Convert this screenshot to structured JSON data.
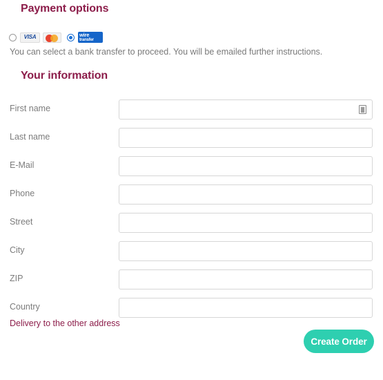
{
  "payment": {
    "heading": "Payment options",
    "note": "You can select a bank transfer to proceed. You will be emailed further instructions.",
    "options": [
      {
        "id": "card",
        "selected": false,
        "radio_name": "payment-radio-card",
        "logos": [
          {
            "name": "visa-logo",
            "text": "VISA"
          },
          {
            "name": "mastercard-logo",
            "text": ""
          }
        ]
      },
      {
        "id": "wire",
        "selected": true,
        "radio_name": "payment-radio-wire",
        "logos": [
          {
            "name": "wire-transfer-logo",
            "line1": "wire",
            "line2": "transfer"
          }
        ]
      }
    ],
    "wire_logo_line1": "wire",
    "wire_logo_line2": "transfer",
    "visa_logo_text": "VISA"
  },
  "information": {
    "heading": "Your information",
    "fields": [
      {
        "label": "First name",
        "value": "",
        "placeholder": "",
        "name": "first-name-input",
        "has_autofill_icon": true
      },
      {
        "label": "Last name",
        "value": "",
        "placeholder": "",
        "name": "last-name-input",
        "has_autofill_icon": false
      },
      {
        "label": "E-Mail",
        "value": "",
        "placeholder": "",
        "name": "email-input",
        "has_autofill_icon": false
      },
      {
        "label": "Phone",
        "value": "",
        "placeholder": "",
        "name": "phone-input",
        "has_autofill_icon": false
      },
      {
        "label": "Street",
        "value": "",
        "placeholder": "",
        "name": "street-input",
        "has_autofill_icon": false
      },
      {
        "label": "City",
        "value": "",
        "placeholder": "",
        "name": "city-input",
        "has_autofill_icon": false
      },
      {
        "label": "ZIP",
        "value": "",
        "placeholder": "",
        "name": "zip-input",
        "has_autofill_icon": false
      },
      {
        "label": "Country",
        "value": "",
        "placeholder": "",
        "name": "country-input",
        "has_autofill_icon": false
      }
    ]
  },
  "footer": {
    "delivery_link": "Delivery to the other address",
    "submit_label": "Create Order"
  },
  "colors": {
    "heading": "#8c1d4a",
    "link": "#8c1d4a",
    "submit_bg": "#2ecfb0",
    "label_text": "#7c7c7c",
    "input_border": "#d6d6d6",
    "radio_selected": "#1a6fd4",
    "visa_blue": "#1a4a9c",
    "wire_blue": "#1565c9"
  },
  "layout": {
    "row_top_start": 144,
    "row_step": 41
  }
}
